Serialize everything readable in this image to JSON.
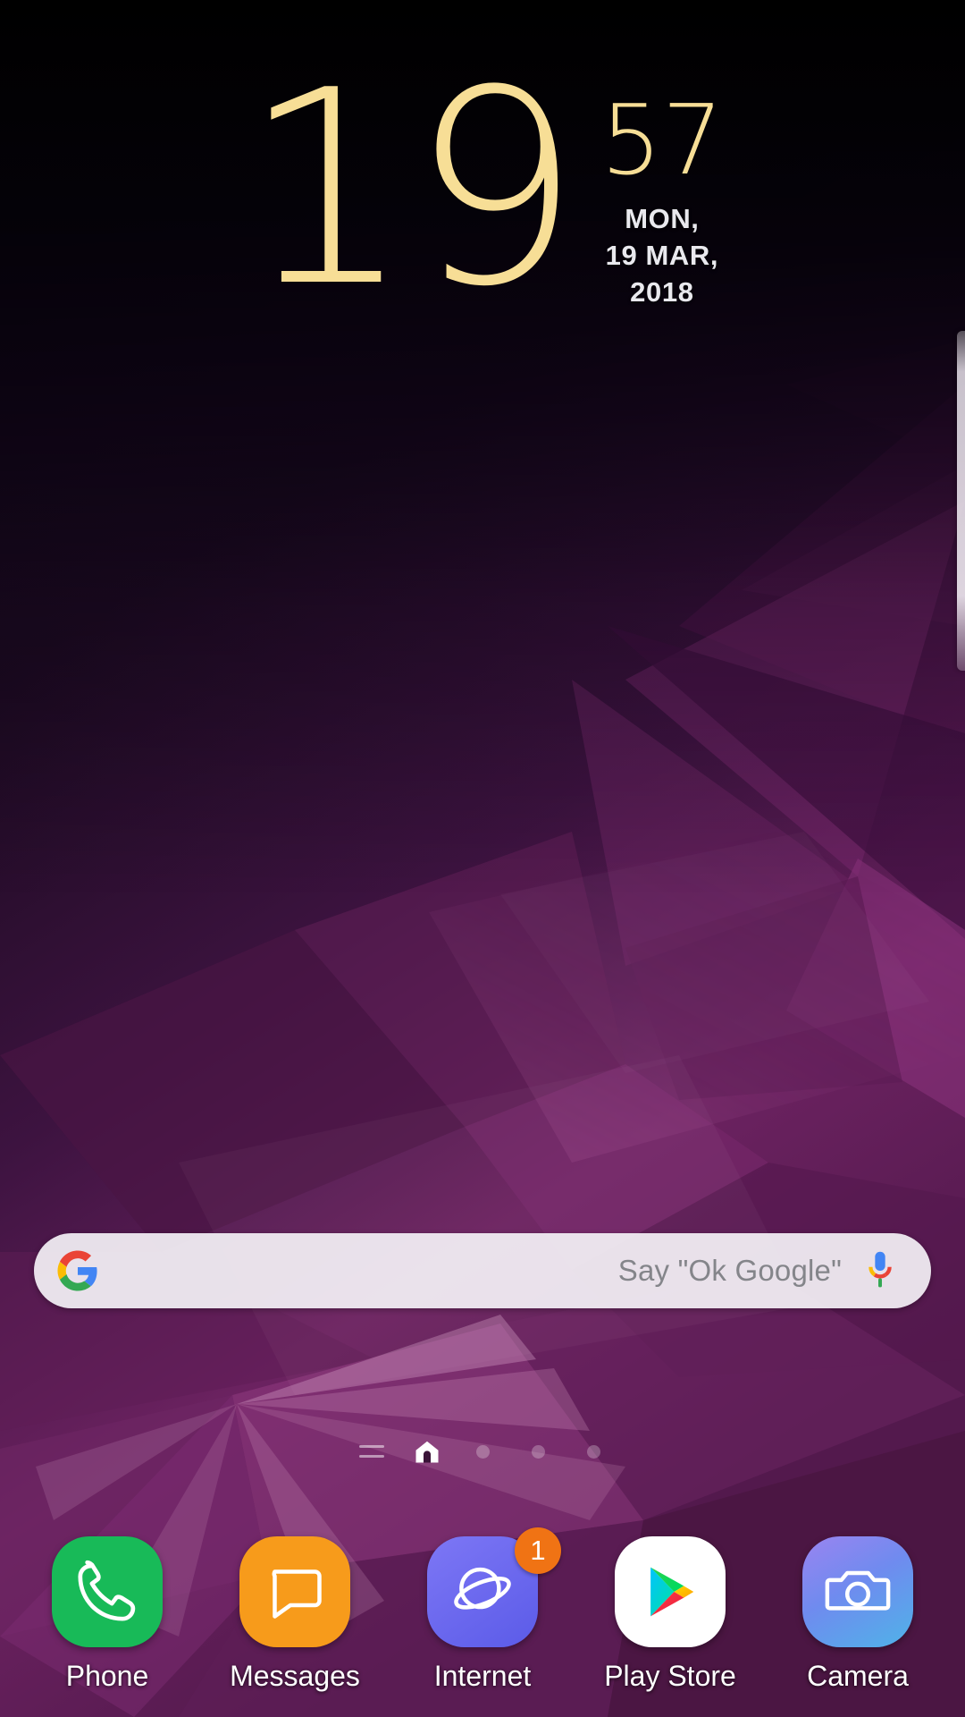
{
  "clock": {
    "hour": "19",
    "minute": "57",
    "weekday": "MON,",
    "date": "19 MAR,",
    "year": "2018",
    "accent_color": "#F7DE96",
    "date_color": "#E9E9EE"
  },
  "search": {
    "placeholder": "Say \"Ok Google\"",
    "logo_icon": "google-g-icon",
    "mic_icon": "microphone-icon",
    "background_color": "#F3F0F5"
  },
  "page_indicators": {
    "bixby_icon": "bixby-hamburger-icon",
    "home_icon": "home-icon",
    "dots": [
      "page-dot-2",
      "page-dot-3",
      "page-dot-4"
    ],
    "active_page": 1,
    "total_pages": 5
  },
  "edge_panel": {
    "handle_label": "edge-panel-handle"
  },
  "dock": {
    "apps": [
      {
        "label": "Phone",
        "icon": "phone-handset-icon",
        "color": "#18BA58",
        "badge": null
      },
      {
        "label": "Messages",
        "icon": "speech-bubble-icon",
        "color": "#F79B1B",
        "badge": null
      },
      {
        "label": "Internet",
        "icon": "planet-orbit-icon",
        "color": "#6B6BF0",
        "badge": "1"
      },
      {
        "label": "Play Store",
        "icon": "play-triangle-icon",
        "color": "#FFFFFF",
        "badge": null
      },
      {
        "label": "Camera",
        "icon": "camera-icon",
        "color": "#5C8BEA",
        "badge": null
      }
    ],
    "badge_color": "#F07314"
  },
  "wallpaper": {
    "name": "galaxy-s9-purple-polygon-wallpaper",
    "top_color": "#000000",
    "accent_color": "#9B3A86"
  }
}
